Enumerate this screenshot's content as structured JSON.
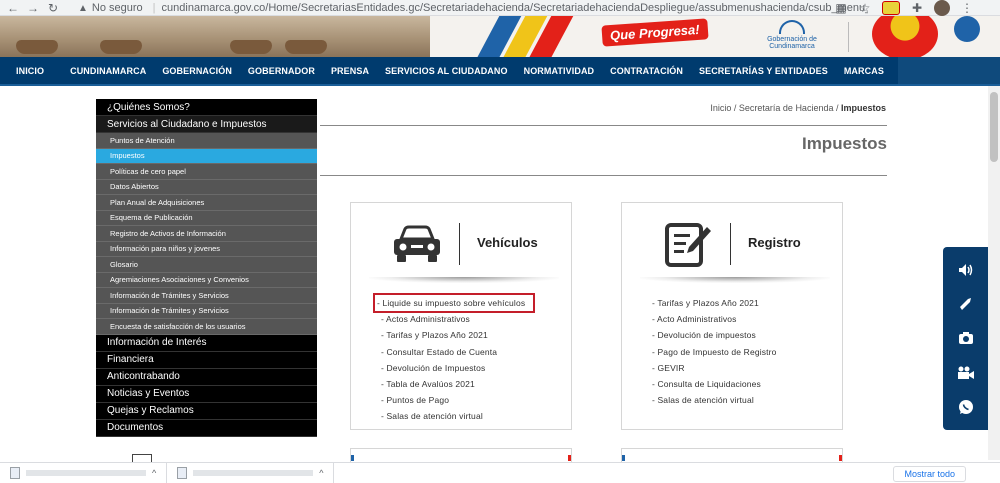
{
  "browser": {
    "security_label": "No seguro",
    "url": "cundinamarca.gov.co/Home/SecretariasEntidades.gc/Secretariadehacienda/SecretariadehaciendaDespliegue/assubmenushacienda/csub_menu_hacienda_..."
  },
  "banner": {
    "slogan": "Que Progresa!",
    "gov_logo_text": "Gobernación de Cundinamarca"
  },
  "mainnav": {
    "items": [
      "INICIO",
      "CUNDINAMARCA",
      "GOBERNACIÓN",
      "GOBERNADOR",
      "PRENSA",
      "SERVICIOS AL CIUDADANO",
      "NORMATIVIDAD",
      "CONTRATACIÓN",
      "SECRETARÍAS Y ENTIDADES",
      "MARCAS"
    ]
  },
  "leftmenu": {
    "quienes": "¿Quiénes Somos?",
    "servicios": "Servicios al Ciudadano e Impuestos",
    "sub": [
      "Puntos de Atención",
      "Impuestos",
      "Políticas de cero papel",
      "Datos Abiertos",
      "Plan Anual de Adquisiciones",
      "Esquema de Publicación",
      "Registro de Activos de Información",
      "Información para niños y jovenes",
      "Glosario",
      "Agremiaciones Asociaciones y Convenios",
      "Información de Trámites y Servicios",
      "Información de Trámites y Servicios",
      "Encuesta de satisfacción de los usuarios"
    ],
    "sections": [
      "Información de Interés",
      "Financiera",
      "Anticontrabando",
      "Noticias y Eventos",
      "Quejas y Reclamos",
      "Documentos"
    ]
  },
  "breadcrumb": {
    "inicio": "Inicio",
    "sep": " / ",
    "secretaria": "Secretaría de Hacienda",
    "current": "Impuestos"
  },
  "page": {
    "title": "Impuestos"
  },
  "cards": {
    "vehiculos": {
      "title": "Vehículos",
      "icon": "car-icon",
      "links": [
        "- Liquide su impuesto sobre vehículos",
        "- Actos Administrativos",
        "- Tarifas y Plazos Año 2021",
        "- Consultar Estado de Cuenta",
        "- Devolución de Impuestos",
        "- Tabla de Avalúos 2021",
        "- Puntos de Pago",
        "- Salas de atención virtual"
      ]
    },
    "registro": {
      "title": "Registro",
      "icon": "document-edit-icon",
      "links": [
        "- Tarifas y Plazos Año 2021",
        "- Acto Administrativos",
        "- Devolución de impuestos",
        "- Pago de Impuesto de Registro",
        "- GEVIR",
        "- Consulta de Liquidaciones",
        "- Salas de atención virtual"
      ]
    }
  },
  "a11y_toolbar": {
    "icons": [
      "speaker-icon",
      "sign-language-icon",
      "camera-icon",
      "video-icon",
      "whatsapp-icon"
    ]
  },
  "downloads": {
    "show_all": "Mostrar todo"
  },
  "colors": {
    "nav_blue": "#003b6e",
    "menu_active": "#2aa9e0",
    "highlight_red": "#c41e2a",
    "toolbar_blue": "#0a3c6b"
  }
}
